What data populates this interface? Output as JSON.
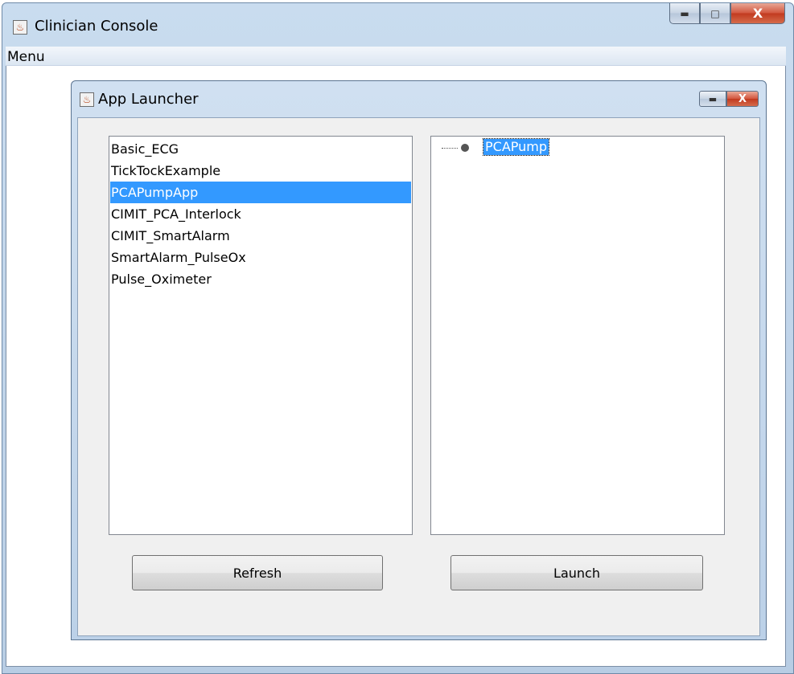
{
  "outer_window": {
    "title": "Clinician Console",
    "icon": "java-app-icon",
    "controls": {
      "minimize": "minimize-icon",
      "maximize": "maximize-icon",
      "close": "close-icon",
      "close_glyph": "X"
    }
  },
  "menubar": {
    "items": [
      {
        "label": "Menu"
      }
    ]
  },
  "inner_window": {
    "title": "App Launcher",
    "icon": "java-app-icon",
    "controls": {
      "minimize": "minimize-icon",
      "close": "close-icon",
      "close_glyph": "X"
    }
  },
  "app_list": {
    "items": [
      {
        "label": "Basic_ECG"
      },
      {
        "label": "TickTockExample"
      },
      {
        "label": "PCAPumpApp",
        "selected": true
      },
      {
        "label": "CIMIT_PCA_Interlock"
      },
      {
        "label": "CIMIT_SmartAlarm"
      },
      {
        "label": "SmartAlarm_PulseOx"
      },
      {
        "label": "Pulse_Oximeter"
      }
    ]
  },
  "device_tree": {
    "nodes": [
      {
        "label": "PCAPump",
        "selected": true,
        "icon": "tree-leaf-icon"
      }
    ]
  },
  "buttons": {
    "refresh": "Refresh",
    "launch": "Launch"
  },
  "colors": {
    "selection": "#3399ff",
    "title_bar": "#c9dcef",
    "close_button": "#c13a1f"
  }
}
